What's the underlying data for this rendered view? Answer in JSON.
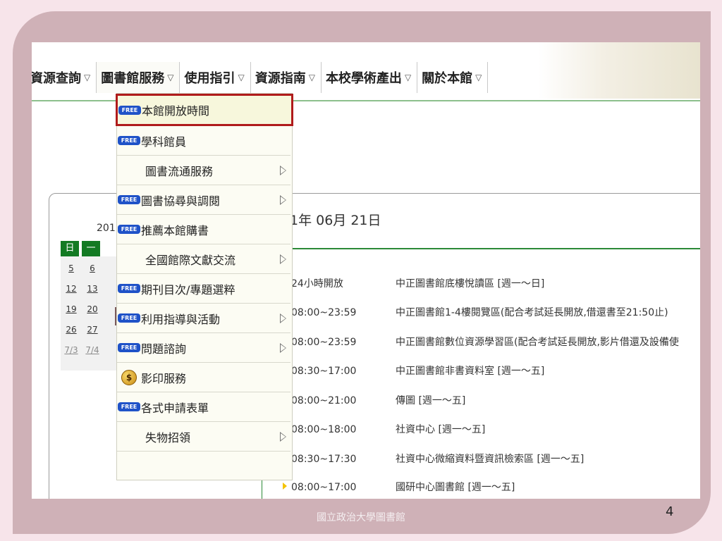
{
  "nav": {
    "items": [
      {
        "label": "資源查詢",
        "caret": "▽"
      },
      {
        "label": "圖書館服務",
        "caret": "▽"
      },
      {
        "label": "使用指引",
        "caret": "▽"
      },
      {
        "label": "資源指南",
        "caret": "▽"
      },
      {
        "label": "本校學術產出",
        "caret": "▽"
      },
      {
        "label": "關於本館",
        "caret": "▽"
      }
    ]
  },
  "dropdown": {
    "badge_text": "FREE",
    "coin_text": "$",
    "items": [
      {
        "label": "本館開放時間",
        "icon": "free-badge",
        "submenu": false,
        "selected": true
      },
      {
        "label": "學科館員",
        "icon": "free-badge",
        "submenu": false
      },
      {
        "label": "圖書流通服務",
        "icon": "none",
        "submenu": true
      },
      {
        "label": "圖書協尋與調閱",
        "icon": "free-badge",
        "submenu": true
      },
      {
        "label": "推薦本館購書",
        "icon": "free-badge",
        "submenu": false
      },
      {
        "label": "全國館際文獻交流",
        "icon": "none",
        "submenu": true
      },
      {
        "label": "期刊目次/專題選粹",
        "icon": "free-badge",
        "submenu": false
      },
      {
        "label": "利用指導與活動",
        "icon": "free-badge",
        "submenu": true
      },
      {
        "label": "問題諮詢",
        "icon": "free-badge",
        "submenu": true
      },
      {
        "label": "影印服務",
        "icon": "coin-icon",
        "submenu": false
      },
      {
        "label": "各式申請表單",
        "icon": "free-badge",
        "submenu": false
      },
      {
        "label": "失物招領",
        "icon": "none",
        "submenu": true
      }
    ]
  },
  "calendar": {
    "year_fragment": "201",
    "headers": [
      "日",
      "一"
    ],
    "rows": [
      [
        "5",
        "6"
      ],
      [
        "12",
        "13"
      ],
      [
        "19",
        "20"
      ],
      [
        "26",
        "27"
      ],
      [
        "7/3",
        "7/4"
      ]
    ]
  },
  "hours": {
    "date_title": "1年 06月 21日",
    "rows": [
      {
        "time": "24小時開放",
        "place": "中正圖書館底樓悅讀區 [週一～日]"
      },
      {
        "time": "08:00~23:59",
        "place": "中正圖書館1-4樓閱覽區(配合考試延長開放,借還書至21:50止)"
      },
      {
        "time": "08:00~23:59",
        "place": "中正圖書館數位資源學習區(配合考試延長開放,影片借還及設備使"
      },
      {
        "time": "08:30~17:00",
        "place": "中正圖書館非書資料室 [週一～五]"
      },
      {
        "time": "08:00~21:00",
        "place": "傳圖 [週一～五]"
      },
      {
        "time": "08:00~18:00",
        "place": "社資中心 [週一～五]"
      },
      {
        "time": "08:30~17:30",
        "place": "社資中心微縮資料暨資訊檢索區 [週一～五]"
      },
      {
        "time": "08:00~17:00",
        "place": "國研中心圖書館 [週一～五]"
      }
    ]
  },
  "footer": {
    "text": "國立政治大學圖書館",
    "page_number": "4"
  },
  "colors": {
    "selected_border": "#b01b1b",
    "free_badge": "#1f52c8",
    "calendar_header": "#137a23",
    "rule_green": "#2c8a37"
  }
}
